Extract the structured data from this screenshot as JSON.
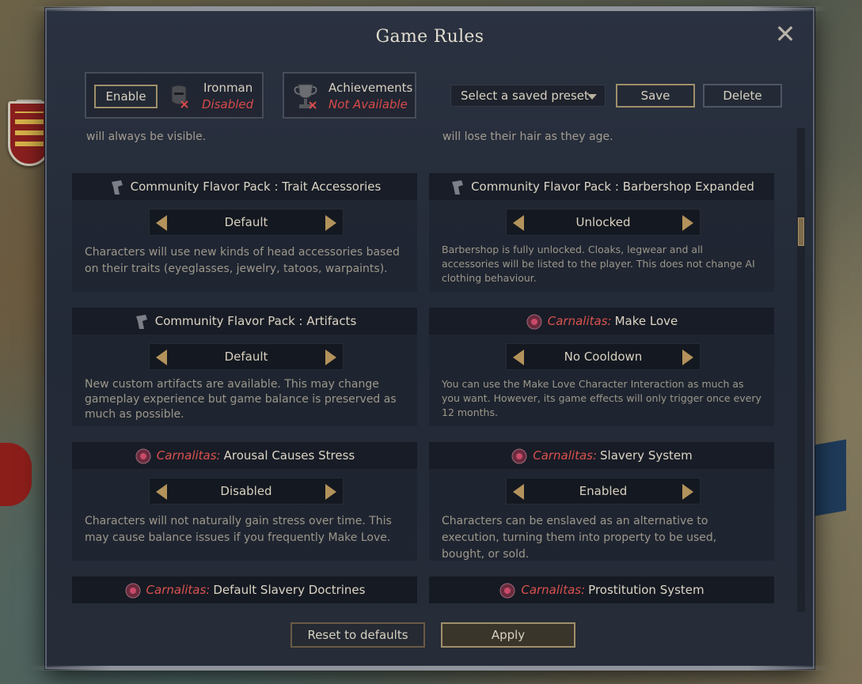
{
  "window": {
    "title": "Game Rules",
    "close_label": "✕"
  },
  "ironman": {
    "enable_label": "Enable",
    "label": "Ironman",
    "status": "Disabled"
  },
  "achievements": {
    "label": "Achievements",
    "status": "Not Available"
  },
  "preset": {
    "placeholder": "Select a saved preset",
    "save_label": "Save",
    "delete_label": "Delete"
  },
  "cut_text": {
    "left": "will always be visible.",
    "right": "will lose their hair as they age."
  },
  "rules": [
    {
      "prefix": "",
      "icon": "flavor-pack-icon",
      "title": "Community Flavor Pack : Trait Accessories",
      "value": "Default",
      "description": "Characters will use new kinds of head accessories based on their traits (eyeglasses, jewelry, tatoos, warpaints)."
    },
    {
      "prefix": "",
      "icon": "flavor-pack-icon",
      "title": "Community Flavor Pack : Barbershop Expanded",
      "value": "Unlocked",
      "description": "Barbershop is fully unlocked. Cloaks, legwear and all accessories will be listed to the player. This does not change AI clothing behaviour."
    },
    {
      "prefix": "",
      "icon": "flavor-pack-icon",
      "title": "Community Flavor Pack : Artifacts",
      "value": "Default",
      "description": "New custom artifacts are available. This may change gameplay experience but game balance is preserved as much as possible."
    },
    {
      "prefix": "Carnalitas:",
      "icon": "carnalitas-icon",
      "title": "Make Love",
      "value": "No Cooldown",
      "description": "You can use the Make Love Character Interaction as much as you want. However, its game effects will only trigger once every 12 months."
    },
    {
      "prefix": "Carnalitas:",
      "icon": "carnalitas-icon",
      "title": "Arousal Causes Stress",
      "value": "Disabled",
      "description": "Characters will not naturally gain stress over time. This may cause balance issues if you frequently Make Love."
    },
    {
      "prefix": "Carnalitas:",
      "icon": "carnalitas-icon",
      "title": "Slavery System",
      "value": "Enabled",
      "description": "Characters can be enslaved as an alternative to execution, turning them into property to be used, bought, or sold."
    },
    {
      "prefix": "Carnalitas:",
      "icon": "carnalitas-icon",
      "title": "Default Slavery Doctrines"
    },
    {
      "prefix": "Carnalitas:",
      "icon": "carnalitas-icon",
      "title": "Prostitution System"
    }
  ],
  "footer": {
    "reset_label": "Reset to defaults",
    "apply_label": "Apply"
  }
}
